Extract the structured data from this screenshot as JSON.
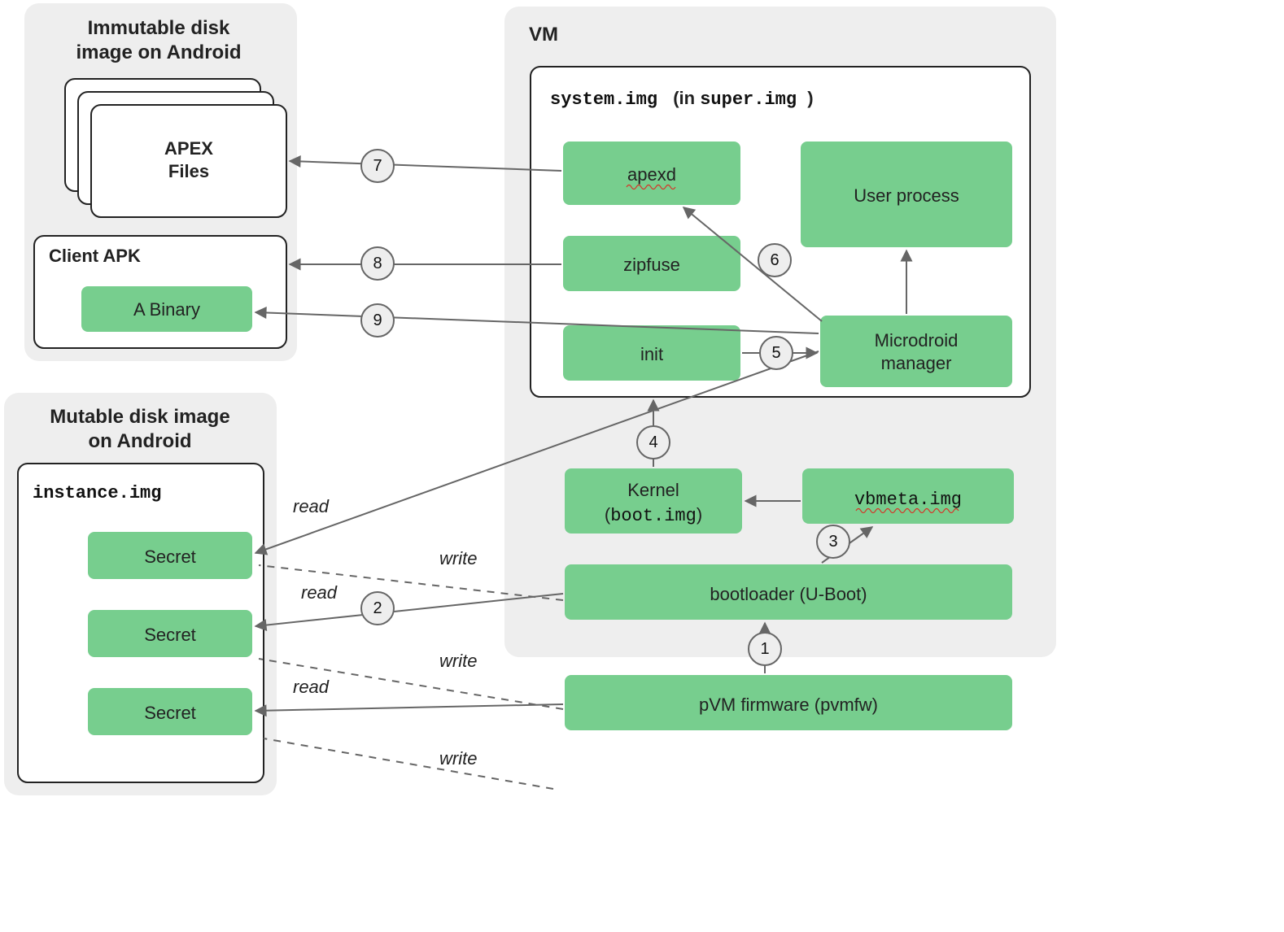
{
  "immutable": {
    "title_l1": "Immutable disk",
    "title_l2": "image on Android",
    "apex_l1": "APEX",
    "apex_l2": "Files",
    "clientApk": "Client APK",
    "aBinary": "A Binary"
  },
  "mutable": {
    "title_l1": "Mutable disk image",
    "title_l2": "on Android",
    "instance": "instance.img",
    "secret": "Secret"
  },
  "vm": {
    "title": "VM",
    "system_a": "system.img",
    "system_b": "(in ",
    "system_c": "super.img",
    "system_d": ")",
    "apexd": "apexd",
    "userProcess": "User process",
    "zipfuse": "zipfuse",
    "init": "init",
    "microdroid_l1": "Microdroid",
    "microdroid_l2": "manager",
    "kernel_l1": "Kernel",
    "kernel_l2a": "(",
    "kernel_l2b": "boot.img",
    "kernel_l2c": ")",
    "vbmeta": "vbmeta.img",
    "bootloader": "bootloader (U-Boot)",
    "pvmfw": "pVM firmware (pvmfw)"
  },
  "edges": {
    "read": "read",
    "write": "write"
  },
  "nums": {
    "n1": "1",
    "n2": "2",
    "n3": "3",
    "n4": "4",
    "n5": "5",
    "n6": "6",
    "n7": "7",
    "n8": "8",
    "n9": "9"
  }
}
